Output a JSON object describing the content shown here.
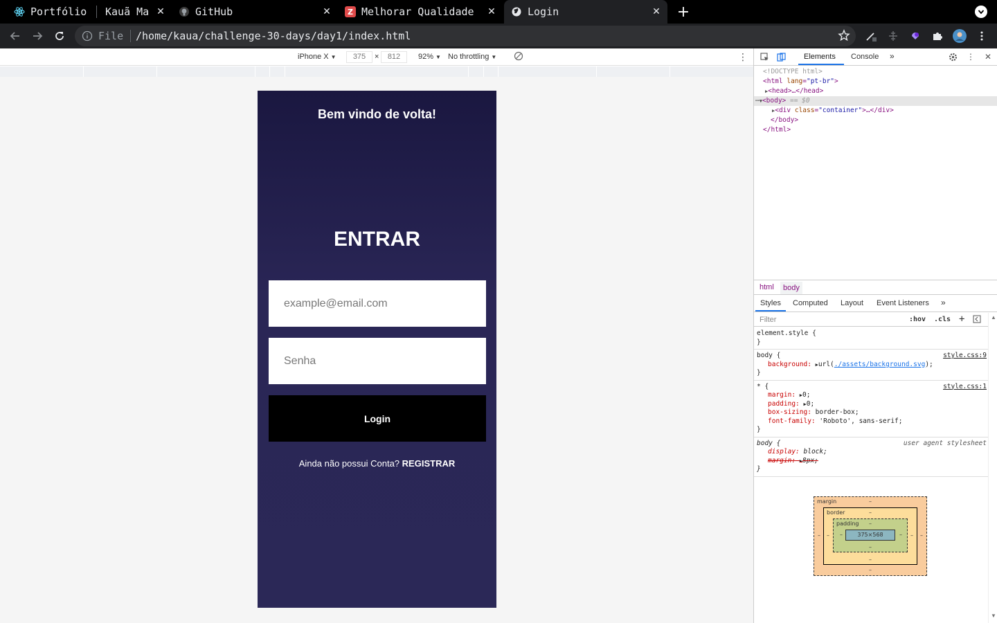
{
  "browser": {
    "tabs": [
      {
        "label": "Portfólio",
        "icon": "react-icon"
      },
      {
        "label": "Kauã Ma",
        "icon": "none"
      },
      {
        "label": "GitHub",
        "icon": "github-icon"
      },
      {
        "label": "Melhorar Qualidade",
        "icon": "zapier-icon"
      },
      {
        "label": "Login",
        "icon": "globe-icon",
        "active": true
      }
    ],
    "url_scheme": "File",
    "url": "/home/kaua/challenge-30-days/day1/index.html"
  },
  "device_toolbar": {
    "device": "iPhone X",
    "width": "375",
    "times": "×",
    "height": "812",
    "zoom": "92%",
    "throttling": "No throttling"
  },
  "page": {
    "welcome": "Bem vindo de volta!",
    "heading": "ENTRAR",
    "email_placeholder": "example@email.com",
    "password_placeholder": "Senha",
    "login_label": "Login",
    "register_prompt": "Ainda não possui Conta?",
    "register_link": "REGISTRAR",
    "colors": {
      "background_top": "#1a1740",
      "background_bottom": "#2b2857",
      "button": "#000000"
    }
  },
  "devtools": {
    "tabs": [
      "Elements",
      "Console"
    ],
    "dom": {
      "doctype": "<!DOCTYPE html>",
      "html_open_tag": "<html",
      "lang_attr": "lang",
      "lang_value": "\"pt-br\"",
      "head": "<head>…</head>",
      "body_open": "<body>",
      "body_marker": "== $0",
      "div_open": "<div",
      "class_attr": "class",
      "class_value": "\"container\"",
      "div_rest": ">…</div>",
      "body_close": "</body>",
      "html_close": "</html>"
    },
    "breadcrumb": [
      "html",
      "body"
    ],
    "style_tabs": [
      "Styles",
      "Computed",
      "Layout",
      "Event Listeners"
    ],
    "filter_placeholder": "Filter",
    "hov": ":hov",
    "cls": ".cls",
    "rules": {
      "element_style": "element.style {",
      "close": "}",
      "body_selector": "body {",
      "body_src": "style.css:9",
      "bg_prop": "background:",
      "bg_url_prefix": "url(",
      "bg_url": "./assets/background.svg",
      "bg_url_suffix": ");",
      "star_selector": "* {",
      "star_src": "style.css:1",
      "margin_prop": "margin:",
      "margin_val": "0;",
      "padding_prop": "padding:",
      "padding_val": "0;",
      "boxsizing_prop": "box-sizing:",
      "boxsizing_val": "border-box;",
      "font_prop": "font-family:",
      "font_val": "'Roboto', sans-serif;",
      "ua_selector": "body {",
      "ua_src": "user agent stylesheet",
      "display_prop": "display:",
      "display_val": "block;",
      "ua_margin_prop": "margin:",
      "ua_margin_val": "8px;"
    },
    "box_model": {
      "margin": "margin",
      "border": "border",
      "padding": "padding",
      "content": "375×568",
      "dash": "–"
    }
  }
}
